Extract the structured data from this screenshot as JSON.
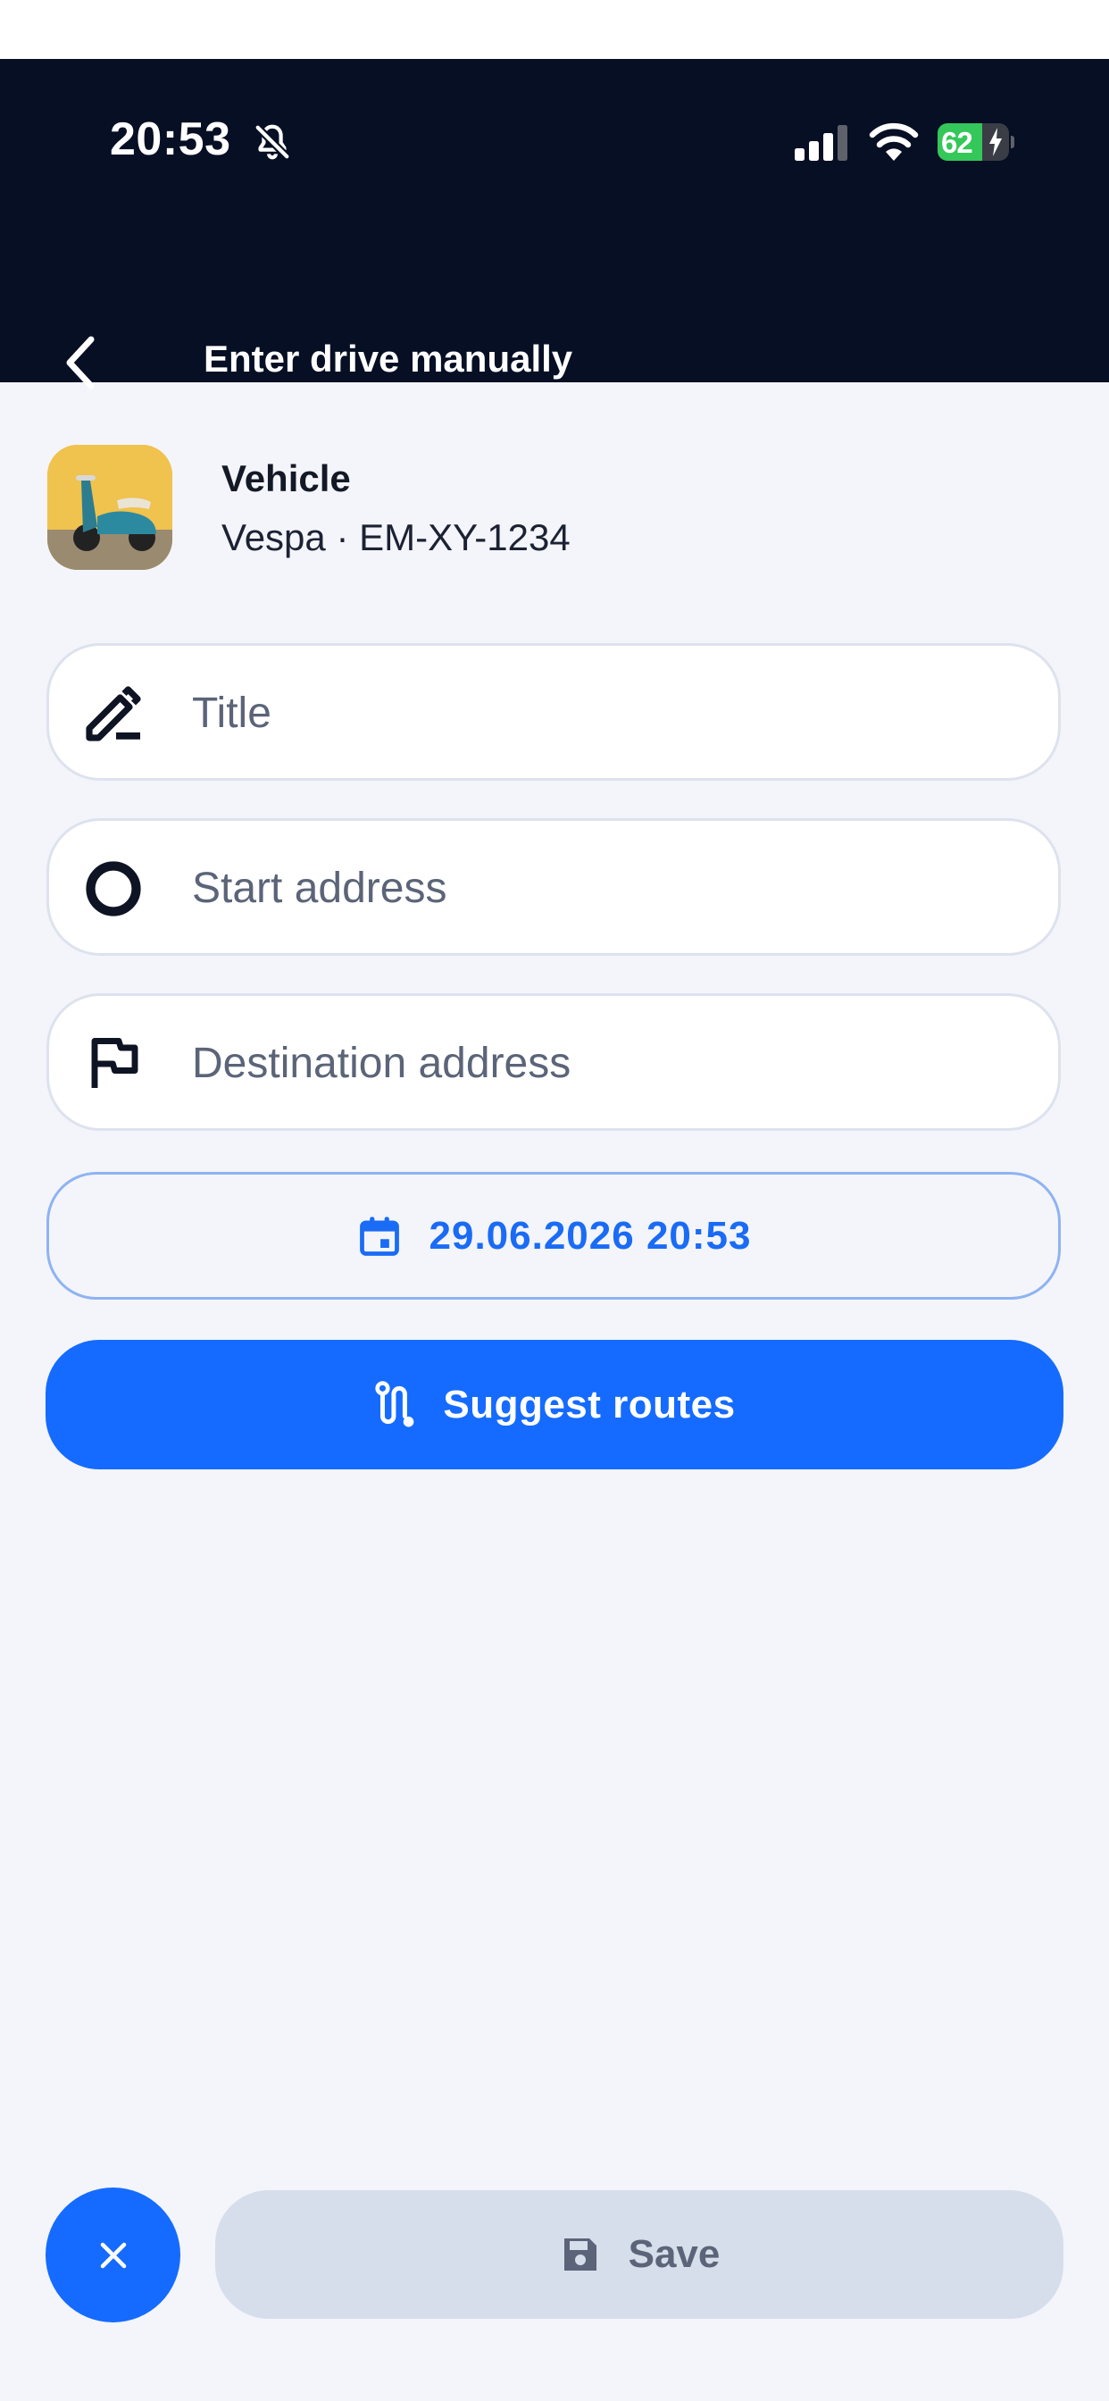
{
  "status_bar": {
    "time": "20:53",
    "battery": "62",
    "battery_level": 0.62
  },
  "header": {
    "title": "Enter drive manually"
  },
  "vehicle": {
    "label": "Vehicle",
    "value": "Vespa · EM-XY-1234"
  },
  "form": {
    "title_placeholder": "Title",
    "start_placeholder": "Start address",
    "destination_placeholder": "Destination address",
    "datetime": "29.06.2026 20:53",
    "suggest_label": "Suggest routes"
  },
  "footer": {
    "save_label": "Save"
  },
  "colors": {
    "accent": "#156bff",
    "header_bg": "#060f24",
    "battery_green": "#34c759"
  },
  "icons": [
    "back-chevron-icon",
    "bell-slash-icon",
    "signal-icon",
    "wifi-icon",
    "battery-icon",
    "edit-pencil-icon",
    "circle-icon",
    "flag-icon",
    "calendar-icon",
    "route-icon",
    "close-icon",
    "floppy-disk-icon"
  ]
}
